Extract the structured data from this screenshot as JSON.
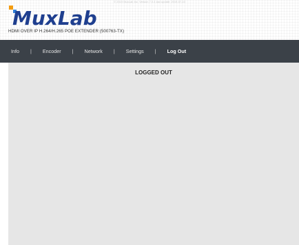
{
  "header": {
    "copyright": "© 2019 MuxLab Inc. Version 7.0.4 last update: 2019-07-10",
    "logo_text": "MuxLab",
    "product_title": "HDMI OVER IP H.264/H.265 POE EXTENDER (500763-TX)"
  },
  "nav": {
    "items": [
      {
        "label": "Info"
      },
      {
        "label": "Encoder"
      },
      {
        "label": "Network"
      },
      {
        "label": "Settings"
      },
      {
        "label": "Log Out"
      }
    ],
    "separator": "|"
  },
  "main": {
    "status": "LOGGED OUT"
  },
  "colors": {
    "nav_bg": "#3b4148",
    "content_bg": "#e6e6e6",
    "logo_blue": "#1f3f8f",
    "logo_dot_orange": "#f39c12",
    "logo_dot_blue": "#2f7ed8"
  }
}
